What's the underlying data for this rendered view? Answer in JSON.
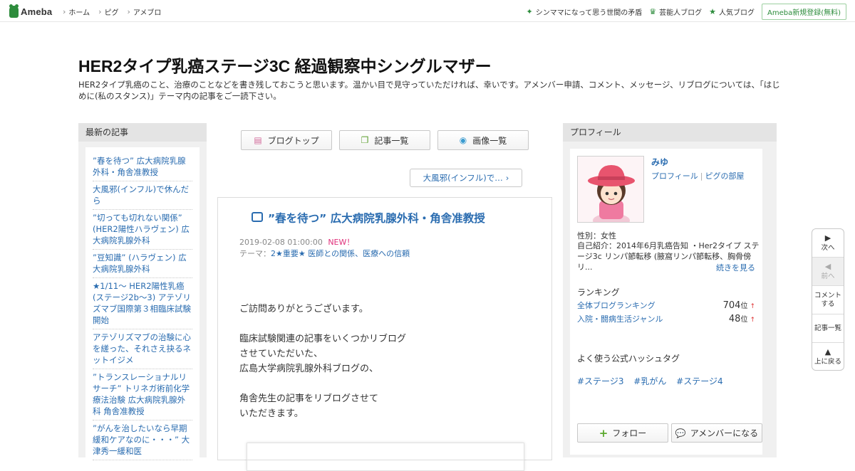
{
  "topbar": {
    "logo": "Ameba",
    "nav": [
      "ホーム",
      "ピグ",
      "アメブロ"
    ],
    "right_links": [
      {
        "label": "シンママになって思う世間の矛盾",
        "icon": "sparkle-icon"
      },
      {
        "label": "芸能人ブログ",
        "icon": "crown-icon"
      },
      {
        "label": "人気ブログ",
        "icon": "star-icon"
      }
    ],
    "register": "Ameba新規登録(無料)"
  },
  "header": {
    "title": "HER2タイプ乳癌ステージ3C 経過観察中シングルマザー",
    "description": "HER2タイプ乳癌のこと、治療のことなどを書き残しておこうと思います。温かい目で見守っていただければ、幸いです。アメンバー申請、コメント、メッセージ、リブログについては、「はじめに(私のスタンス)」テーマ内の記事をご一読下さい。"
  },
  "left": {
    "heading": "最新の記事",
    "items": [
      "”春を待つ” 広大病院乳腺外科・角舎准教授",
      "大風邪(インフル)で休んだら",
      "”切っても切れない関係” (HER2陽性ハラヴェン) 広大病院乳腺外科",
      "”豆知識” (ハラヴェン) 広大病院乳腺外科",
      "★1/11～ HER2陽性乳癌(ステージ2b～3) アテゾリズマブ国際第３相臨床試験開始",
      "アテゾリズマブの治験に心を縒った、それさえ抉るネットイジメ",
      "”トランスレーショナルリサーチ” トリネガ術前化学療法治験 広大病院乳腺外科 角舎准教授",
      "”がんを治したいなら早期緩和ケアなのに・・・” 大津秀一緩和医"
    ]
  },
  "center": {
    "nav": [
      {
        "label": "ブログトップ",
        "icon": "document-icon"
      },
      {
        "label": "記事一覧",
        "icon": "copy-icon"
      },
      {
        "label": "画像一覧",
        "icon": "camera-icon"
      }
    ],
    "pager": "大風邪(インフル)で…",
    "article": {
      "title": "”春を待つ” 広大病院乳腺外科・角舎准教授",
      "date": "2019-02-08 01:00:00",
      "new_badge": "NEW！",
      "theme_label": "テーマ：",
      "theme": "2★重要★ 医師との関係、医療への信頼",
      "paragraphs": [
        "ご訪問ありがとうございます。",
        "臨床試験関連の記事をいくつかリブログ\nさせていただいた、\n広島大学病院乳腺外科ブログの、",
        "角舎先生の記事をリブログさせて\nいただきます。"
      ]
    }
  },
  "right": {
    "heading": "プロフィール",
    "name": "みゆ",
    "links": [
      "プロフィール",
      "ピグの部屋"
    ],
    "gender": "性別：女性",
    "intro": "自己紹介：2014年6月乳癌告知 ・Her2タイプ ステージ3c リンパ節転移 (腋窩リンパ節転移、胸骨傍リ...",
    "more": "続きを見る",
    "ranking_heading": "ランキング",
    "rankings": [
      {
        "label": "全体ブログランキング",
        "value": "704",
        "unit": "位",
        "trend": "↑"
      },
      {
        "label": "入院・闘病生活ジャンル",
        "value": "48",
        "unit": "位",
        "trend": "↑"
      }
    ],
    "tags_heading": "よく使う公式ハッシュタグ",
    "tags": [
      "#ステージ3",
      "#乳がん",
      "#ステージ4"
    ],
    "follow": "フォロー",
    "amember": "アメンバーになる"
  },
  "sidenav": [
    {
      "label": "次へ",
      "arrow": "▶",
      "disabled": false
    },
    {
      "label": "前へ",
      "arrow": "◀",
      "disabled": true
    },
    {
      "label": "コメント\nする",
      "arrow": "",
      "disabled": false
    },
    {
      "label": "記事一覧",
      "arrow": "",
      "disabled": false
    },
    {
      "label": "上に戻る",
      "arrow": "▲",
      "disabled": false
    }
  ],
  "colors": {
    "brand_green": "#2d8c3c",
    "link_blue": "#2a6cb0",
    "new_pink": "#e0307a"
  }
}
